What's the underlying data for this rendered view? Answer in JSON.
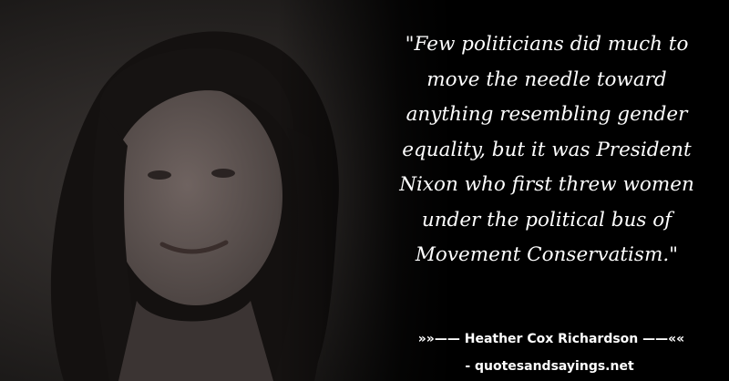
{
  "quote": {
    "lines": [
      "\"Few politicians did much to",
      "move the needle toward",
      "anything resembling gender",
      "equality, but it was President",
      "Nixon who first threw women",
      "under the political bus of",
      "Movement Conservatism.\""
    ]
  },
  "author": {
    "text": "»»—— Heather Cox Richardson ——««"
  },
  "source": {
    "text": "- quotesandsayings.net"
  },
  "colors": {
    "background": "#000000",
    "text": "#ffffff"
  }
}
